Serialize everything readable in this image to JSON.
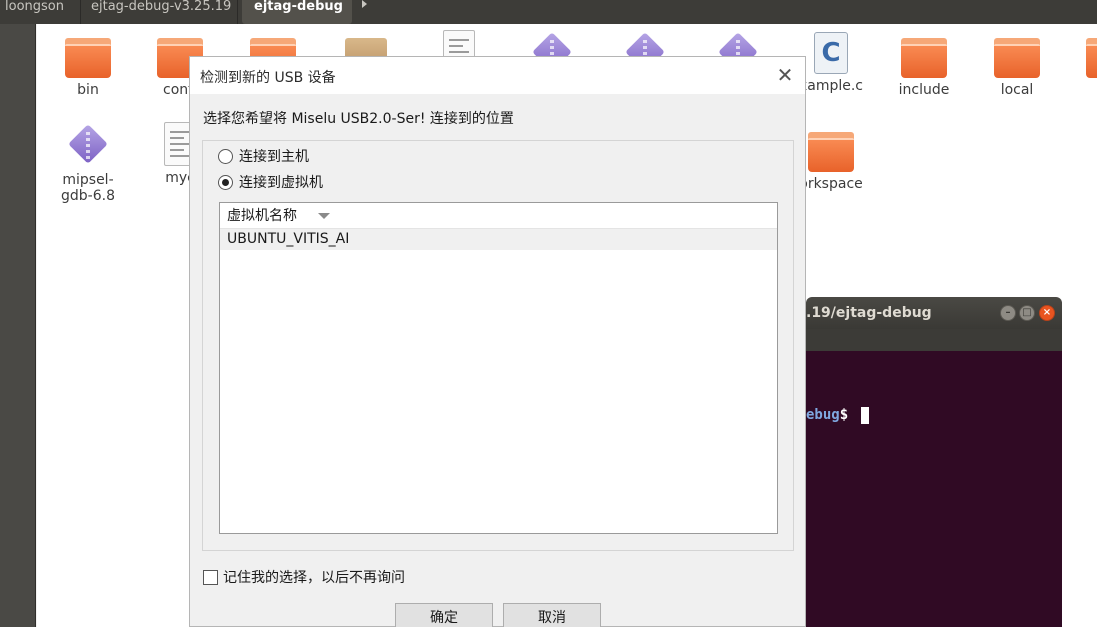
{
  "breadcrumb": {
    "items": [
      "loongson",
      "ejtag-debug-v3.25.19",
      "ejtag-debug"
    ]
  },
  "files": [
    {
      "name": "bin",
      "icon": "folder-icon"
    },
    {
      "name": "confi",
      "icon": "folder-icon"
    },
    {
      "name": "",
      "icon": "folder-icon"
    },
    {
      "name": "",
      "icon": "package-icon"
    },
    {
      "name": "",
      "icon": "text-file-icon"
    },
    {
      "name": "",
      "icon": "executable-icon"
    },
    {
      "name": "",
      "icon": "executable-icon"
    },
    {
      "name": "",
      "icon": "executable-icon"
    },
    {
      "name": "xample.c",
      "icon": "c-source-icon"
    },
    {
      "name": "include",
      "icon": "folder-icon"
    },
    {
      "name": "local",
      "icon": "folder-icon"
    },
    {
      "name": "mipsel-gdb-6.8",
      "icon": "executable-icon"
    },
    {
      "name": "myc",
      "icon": "text-file-icon"
    },
    {
      "name": "orkspace",
      "icon": "folder-icon"
    }
  ],
  "terminal": {
    "title": ".19/ejtag-debug",
    "prompt_path": "ebug",
    "prompt_symbol": "$ "
  },
  "dialog": {
    "title": "检测到新的 USB 设备",
    "close_glyph": "✕",
    "prompt": "选择您希望将 Miselu USB2.0-Ser! 连接到的位置",
    "options": [
      {
        "label": "连接到主机",
        "checked": false
      },
      {
        "label": "连接到虚拟机",
        "checked": true
      }
    ],
    "list": {
      "header": "虚拟机名称",
      "rows": [
        "UBUNTU_VITIS_AI"
      ]
    },
    "remember_label": "记住我的选择，以后不再询问",
    "remember_checked": false,
    "ok_label": "确定",
    "cancel_label": "取消"
  },
  "colors": {
    "folder_orange": "#e8622a",
    "terminal_bg": "#300a24",
    "terminal_close": "#e95420"
  }
}
